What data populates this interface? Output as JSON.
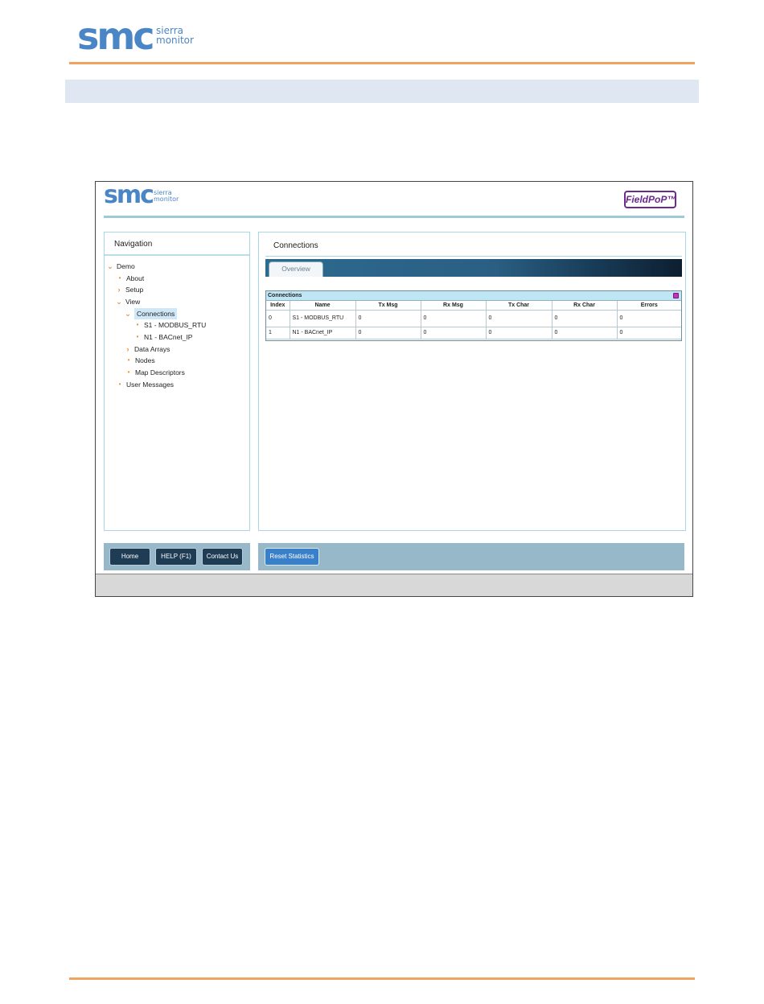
{
  "doc_logo": {
    "brand": "smc",
    "sub_line1": "sierra",
    "sub_line2": "monitor"
  },
  "app": {
    "logo": {
      "brand": "smc",
      "sub_line1": "sierra",
      "sub_line2": "monitor"
    },
    "product_badge": "FieldPoP™"
  },
  "navigation": {
    "title": "Navigation",
    "items": [
      {
        "label": "Demo",
        "icon": "chevron-down-icon"
      },
      {
        "label": "About",
        "icon": "bullet-icon"
      },
      {
        "label": "Setup",
        "icon": "chevron-right-icon"
      },
      {
        "label": "View",
        "icon": "chevron-down-icon"
      },
      {
        "label": "Connections",
        "icon": "chevron-down-icon"
      },
      {
        "label": "S1 - MODBUS_RTU",
        "icon": "bullet-icon"
      },
      {
        "label": "N1 - BACnet_IP",
        "icon": "bullet-icon"
      },
      {
        "label": "Data Arrays",
        "icon": "chevron-right-icon"
      },
      {
        "label": "Nodes",
        "icon": "bullet-icon"
      },
      {
        "label": "Map Descriptors",
        "icon": "bullet-icon"
      },
      {
        "label": "User Messages",
        "icon": "bullet-icon"
      }
    ],
    "selected": "Connections"
  },
  "connections": {
    "title": "Connections",
    "tab": "Overview",
    "table_title": "Connections",
    "columns": [
      "Index",
      "Name",
      "Tx Msg",
      "Rx Msg",
      "Tx Char",
      "Rx Char",
      "Errors"
    ],
    "rows": [
      [
        "0",
        "S1 - MODBUS_RTU",
        "0",
        "0",
        "0",
        "0",
        "0"
      ],
      [
        "1",
        "N1 - BACnet_IP",
        "0",
        "0",
        "0",
        "0",
        "0"
      ]
    ]
  },
  "footer": {
    "home": "Home",
    "help": "HELP (F1)",
    "contact": "Contact Us",
    "reset": "Reset Statistics"
  },
  "colors": {
    "accent_orange": "#f0a360",
    "brand_blue": "#4a86c6",
    "fieldpop_purple": "#6a2a8e"
  }
}
